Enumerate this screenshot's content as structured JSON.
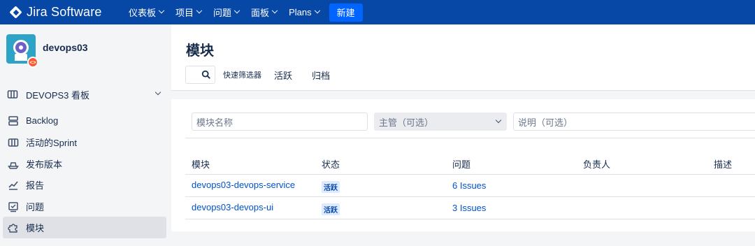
{
  "topnav": {
    "logo_text": "Jira Software",
    "items": [
      "仪表板",
      "项目",
      "问题",
      "面板",
      "Plans"
    ],
    "create_label": "新建"
  },
  "sidebar": {
    "project_name": "devops03",
    "board_label": "DEVOPS3 看板",
    "items": [
      {
        "label": "Backlog",
        "icon": "backlog-icon"
      },
      {
        "label": "活动的Sprint",
        "icon": "board-icon"
      },
      {
        "label": "发布版本",
        "icon": "ship-icon"
      },
      {
        "label": "报告",
        "icon": "chart-icon"
      },
      {
        "label": "问题",
        "icon": "issues-icon"
      },
      {
        "label": "模块",
        "icon": "puzzle-icon"
      }
    ]
  },
  "main": {
    "title": "模块",
    "quick_filters_label": "快速筛选器",
    "tabs": [
      "活跃",
      "归档"
    ],
    "form": {
      "name_placeholder": "模块名称",
      "lead_placeholder": "主管（可选）",
      "desc_placeholder": "说明（可选）"
    },
    "table": {
      "headers": [
        "模块",
        "状态",
        "问题",
        "负责人",
        "描述"
      ],
      "rows": [
        {
          "name": "devops03-devops-service",
          "status": "活跃",
          "issues": "6 Issues"
        },
        {
          "name": "devops03-devops-ui",
          "status": "活跃",
          "issues": "3 Issues"
        }
      ]
    }
  },
  "colors": {
    "nav_bg": "#0747a6",
    "create_btn": "#0065ff",
    "link": "#0052cc",
    "lozenge_bg": "#deebff"
  }
}
